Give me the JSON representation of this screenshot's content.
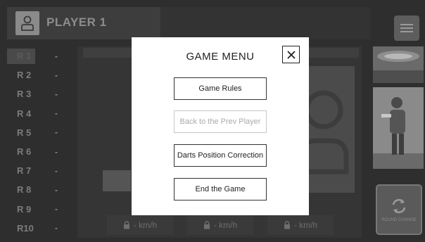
{
  "player": {
    "name": "PLAYER 1",
    "icon": "user-icon"
  },
  "rounds": [
    {
      "label": "R 1",
      "value": "-"
    },
    {
      "label": "R 2",
      "value": "-"
    },
    {
      "label": "R 3",
      "value": "-"
    },
    {
      "label": "R 4",
      "value": "-"
    },
    {
      "label": "R 5",
      "value": "-"
    },
    {
      "label": "R 6",
      "value": "-"
    },
    {
      "label": "R 7",
      "value": "-"
    },
    {
      "label": "R 8",
      "value": "-"
    },
    {
      "label": "R 9",
      "value": "-"
    },
    {
      "label": "R10",
      "value": "-"
    }
  ],
  "speeds": [
    {
      "value": "- km/h",
      "icon": "lock-icon"
    },
    {
      "value": "- km/h",
      "icon": "lock-icon"
    },
    {
      "value": "- km/h",
      "icon": "lock-icon"
    }
  ],
  "right_panel": {
    "menu_icon": "hamburger-icon",
    "rotate_label": "ROUND CHANGE",
    "rotate_icon": "rotate-arrows-icon"
  },
  "modal": {
    "title": "GAME MENU",
    "close_icon": "close-icon",
    "buttons": [
      {
        "label": "Game Rules",
        "enabled": true
      },
      {
        "label": "Back to the Prev Player",
        "enabled": false
      },
      {
        "label": "Darts Position Correction",
        "enabled": true
      },
      {
        "label": "End the Game",
        "enabled": true
      }
    ]
  },
  "colors": {
    "overlay_bg": "#2e2e2e",
    "modal_bg": "#ffffff",
    "disabled_text": "#aaaaaa"
  }
}
